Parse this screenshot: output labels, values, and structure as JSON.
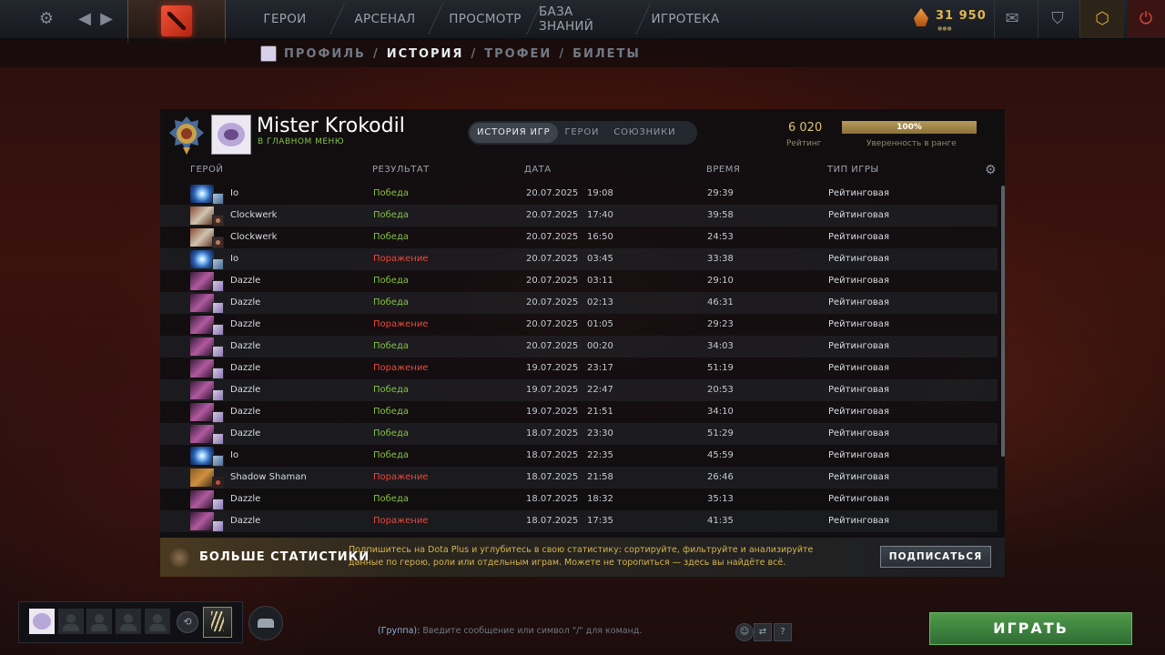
{
  "topbar": {
    "nav": [
      "ГЕРОИ",
      "АРСЕНАЛ",
      "ПРОСМОТР",
      "БАЗА ЗНАНИЙ",
      "ИГРОТЕКА"
    ],
    "shards": "31 950"
  },
  "subnav": {
    "profile": "ПРОФИЛЬ",
    "history": "ИСТОРИЯ",
    "trophies": "ТРОФЕИ",
    "tickets": "БИЛЕТЫ",
    "sep": "/"
  },
  "player": {
    "name": "Mister Krokodil",
    "status": "В ГЛАВНОМ МЕНЮ",
    "rating": "6 020",
    "rating_label": "Рейтинг",
    "confidence": "100%",
    "confidence_label": "Уверенность в ранге"
  },
  "tabs": [
    "ИСТОРИЯ ИГР",
    "ГЕРОИ",
    "СОЮЗНИКИ"
  ],
  "columns": {
    "hero": "ГЕРОЙ",
    "result": "РЕЗУЛЬТАТ",
    "date": "ДАТА",
    "time": "ВРЕМЯ",
    "game_type": "ТИП ИГРЫ"
  },
  "matches": [
    {
      "hero": "Io",
      "icon": "io",
      "result": "Победа",
      "win": true,
      "date": "20.07.2025",
      "time": "19:08",
      "duration": "29:39",
      "type": "Рейтинговая"
    },
    {
      "hero": "Clockwerk",
      "icon": "clockwerk",
      "result": "Победа",
      "win": true,
      "date": "20.07.2025",
      "time": "17:40",
      "duration": "39:58",
      "type": "Рейтинговая"
    },
    {
      "hero": "Clockwerk",
      "icon": "clockwerk",
      "result": "Победа",
      "win": true,
      "date": "20.07.2025",
      "time": "16:50",
      "duration": "24:53",
      "type": "Рейтинговая"
    },
    {
      "hero": "Io",
      "icon": "io",
      "result": "Поражение",
      "win": false,
      "date": "20.07.2025",
      "time": "03:45",
      "duration": "33:38",
      "type": "Рейтинговая"
    },
    {
      "hero": "Dazzle",
      "icon": "dazzle",
      "result": "Победа",
      "win": true,
      "date": "20.07.2025",
      "time": "03:11",
      "duration": "29:10",
      "type": "Рейтинговая"
    },
    {
      "hero": "Dazzle",
      "icon": "dazzle",
      "result": "Победа",
      "win": true,
      "date": "20.07.2025",
      "time": "02:13",
      "duration": "46:31",
      "type": "Рейтинговая"
    },
    {
      "hero": "Dazzle",
      "icon": "dazzle",
      "result": "Поражение",
      "win": false,
      "date": "20.07.2025",
      "time": "01:05",
      "duration": "29:23",
      "type": "Рейтинговая"
    },
    {
      "hero": "Dazzle",
      "icon": "dazzle",
      "result": "Победа",
      "win": true,
      "date": "20.07.2025",
      "time": "00:20",
      "duration": "34:03",
      "type": "Рейтинговая"
    },
    {
      "hero": "Dazzle",
      "icon": "dazzle",
      "result": "Поражение",
      "win": false,
      "date": "19.07.2025",
      "time": "23:17",
      "duration": "51:19",
      "type": "Рейтинговая"
    },
    {
      "hero": "Dazzle",
      "icon": "dazzle",
      "result": "Победа",
      "win": true,
      "date": "19.07.2025",
      "time": "22:47",
      "duration": "20:53",
      "type": "Рейтинговая"
    },
    {
      "hero": "Dazzle",
      "icon": "dazzle",
      "result": "Победа",
      "win": true,
      "date": "19.07.2025",
      "time": "21:51",
      "duration": "34:10",
      "type": "Рейтинговая"
    },
    {
      "hero": "Dazzle",
      "icon": "dazzle",
      "result": "Победа",
      "win": true,
      "date": "18.07.2025",
      "time": "23:30",
      "duration": "51:29",
      "type": "Рейтинговая"
    },
    {
      "hero": "Io",
      "icon": "io",
      "result": "Победа",
      "win": true,
      "date": "18.07.2025",
      "time": "22:35",
      "duration": "45:59",
      "type": "Рейтинговая"
    },
    {
      "hero": "Shadow Shaman",
      "icon": "shaman",
      "result": "Поражение",
      "win": false,
      "date": "18.07.2025",
      "time": "21:58",
      "duration": "26:46",
      "type": "Рейтинговая"
    },
    {
      "hero": "Dazzle",
      "icon": "dazzle",
      "result": "Победа",
      "win": true,
      "date": "18.07.2025",
      "time": "18:32",
      "duration": "35:13",
      "type": "Рейтинговая"
    },
    {
      "hero": "Dazzle",
      "icon": "dazzle",
      "result": "Поражение",
      "win": false,
      "date": "18.07.2025",
      "time": "17:35",
      "duration": "41:35",
      "type": "Рейтинговая"
    }
  ],
  "promo": {
    "title": "БОЛЬШЕ СТАТИСТИКИ",
    "description": "Подпишитесь на Dota Plus и углубитесь в свою статистику: сортируйте, фильтруйте и анализируйте данные по герою, роли или отдельным играм. Можете не торопиться — здесь вы найдёте всё.",
    "button": "ПОДПИСАТЬСЯ"
  },
  "chat": {
    "group": "(Группа):",
    "placeholder": "Введите сообщение или символ \"/\" для команд."
  },
  "play_button": "ИГРАТЬ",
  "colors": {
    "win": "#84c044",
    "loss": "#e84a3a",
    "play": "#3f8a40",
    "gold": "#e3b64a"
  }
}
